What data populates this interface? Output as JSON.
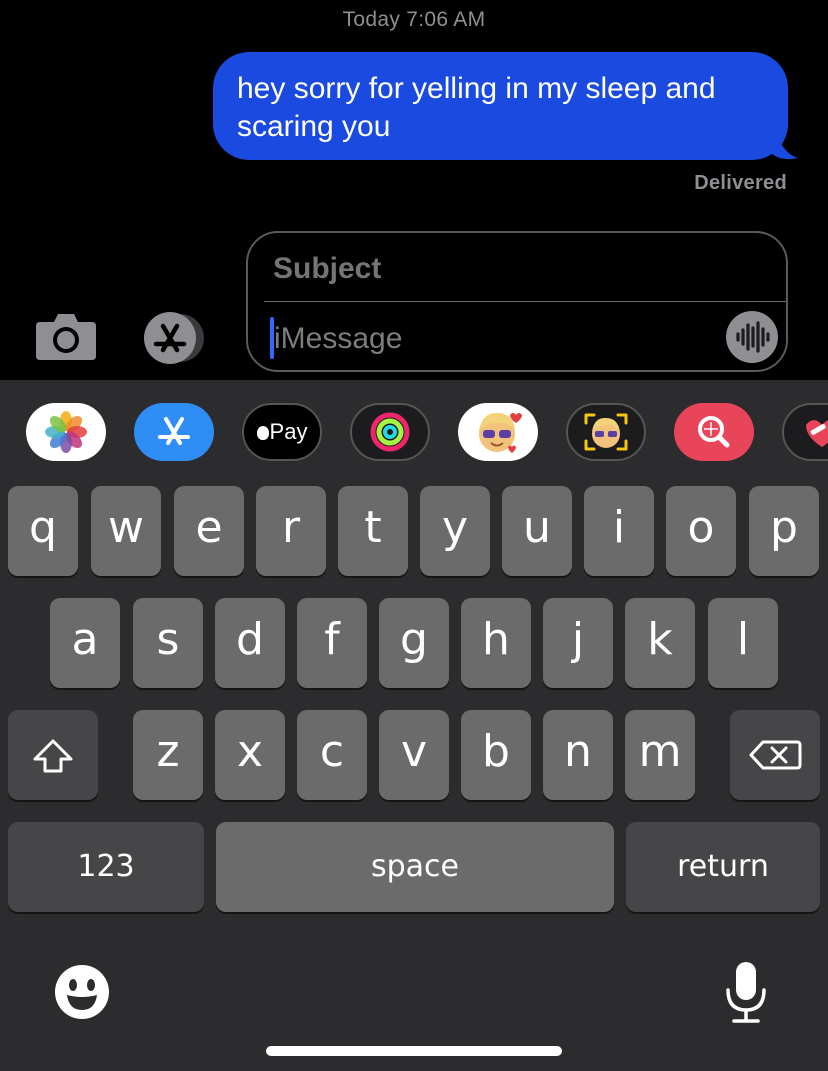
{
  "conversation": {
    "timestamp": "Today 7:06 AM",
    "messages": [
      {
        "text": "hey sorry for yelling in my sleep and scaring you",
        "sender": "me"
      }
    ],
    "status": "Delivered"
  },
  "compose": {
    "subject_placeholder": "Subject",
    "message_placeholder": "iMessage"
  },
  "app_strip": [
    {
      "name": "Photos",
      "icon": "photos-icon"
    },
    {
      "name": "App Store",
      "icon": "app-store-icon"
    },
    {
      "name": "Apple Pay",
      "label": "Pay",
      "icon": "apple-pay-icon"
    },
    {
      "name": "Activity",
      "icon": "activity-rings-icon"
    },
    {
      "name": "Memoji Stickers",
      "icon": "memoji-stickers-icon"
    },
    {
      "name": "Animoji",
      "icon": "animoji-icon"
    },
    {
      "name": "Images Search",
      "icon": "image-search-icon"
    },
    {
      "name": "Stickers",
      "icon": "heart-stickers-icon"
    }
  ],
  "keyboard": {
    "row1": [
      "q",
      "w",
      "e",
      "r",
      "t",
      "y",
      "u",
      "i",
      "o",
      "p"
    ],
    "row2": [
      "a",
      "s",
      "d",
      "f",
      "g",
      "h",
      "j",
      "k",
      "l"
    ],
    "row3": [
      "z",
      "x",
      "c",
      "v",
      "b",
      "n",
      "m"
    ],
    "numbers_label": "123",
    "space_label": "space",
    "return_label": "return"
  },
  "colors": {
    "bubble": "#1b4ae0",
    "keyboard_bg": "#2c2c2e",
    "key": "#6b6b6b",
    "key_dark": "#464648",
    "cursor": "#2f6bff"
  }
}
